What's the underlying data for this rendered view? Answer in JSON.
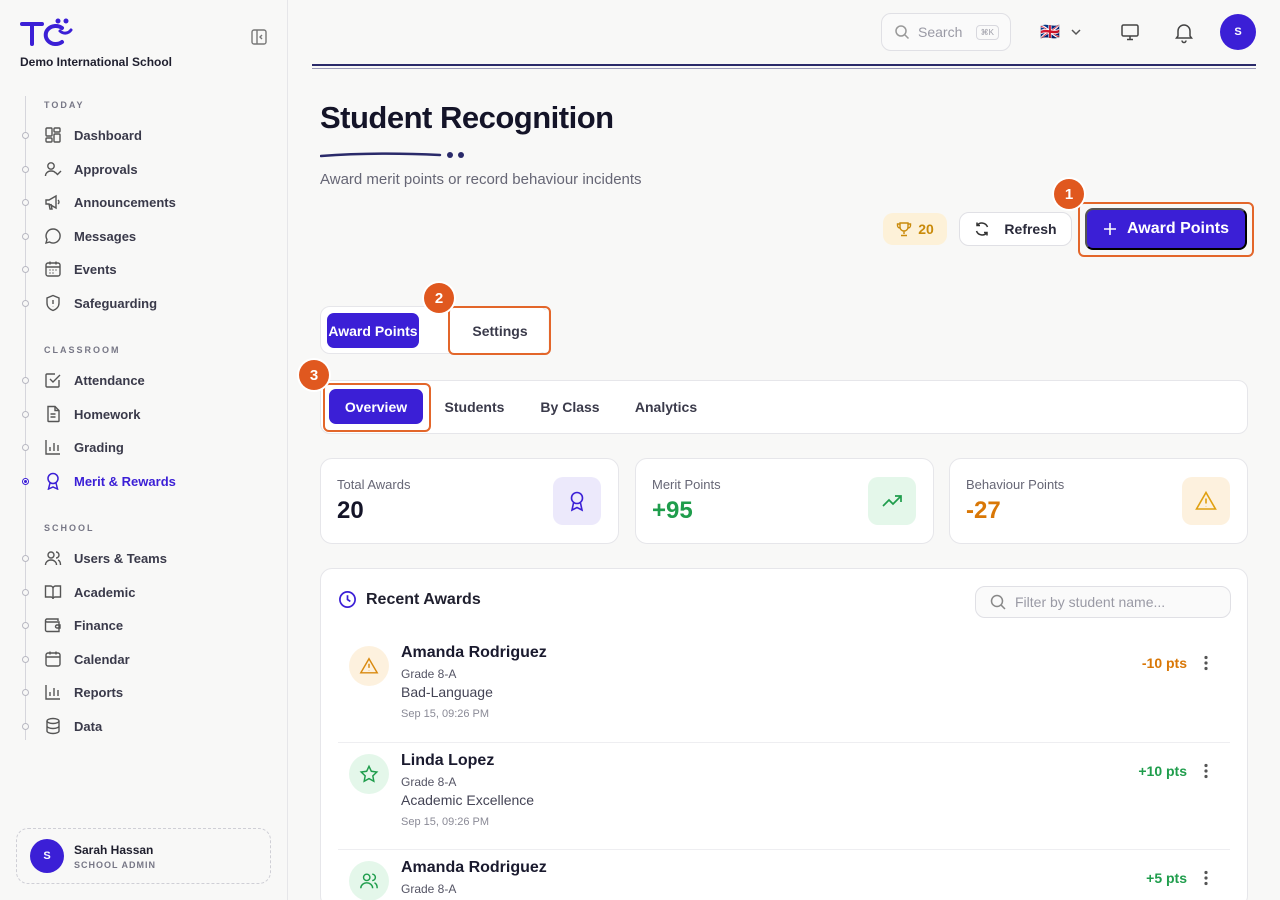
{
  "sidebar": {
    "school_name": "Demo International School",
    "sections": {
      "today": "TODAY",
      "classroom": "CLASSROOM",
      "school": "SCHOOL"
    },
    "items": {
      "dashboard": "Dashboard",
      "approvals": "Approvals",
      "announcements": "Announcements",
      "messages": "Messages",
      "events": "Events",
      "safeguarding": "Safeguarding",
      "attendance": "Attendance",
      "homework": "Homework",
      "grading": "Grading",
      "merit": "Merit & Rewards",
      "users": "Users & Teams",
      "academic": "Academic",
      "finance": "Finance",
      "calendar": "Calendar",
      "reports": "Reports",
      "data": "Data"
    },
    "active_item": "merit",
    "user": {
      "initial": "S",
      "name": "Sarah Hassan",
      "role": "SCHOOL ADMIN"
    }
  },
  "topbar": {
    "search_placeholder": "Search",
    "search_shortcut": "⌘K",
    "language_flag": "🇬🇧",
    "avatar_initial": "S"
  },
  "header": {
    "title": "Student Recognition",
    "subtitle": "Award merit points or record behaviour incidents",
    "points_count": "20",
    "refresh_label": "Refresh",
    "award_label": "Award Points"
  },
  "callouts": [
    "1",
    "2",
    "3"
  ],
  "primary_tabs": {
    "award": "Award Points",
    "settings": "Settings"
  },
  "sub_tabs": {
    "overview": "Overview",
    "students": "Students",
    "by_class": "By Class",
    "analytics": "Analytics"
  },
  "stats": [
    {
      "label": "Total Awards",
      "value": "20",
      "color": "#141428"
    },
    {
      "label": "Merit Points",
      "value": "+95",
      "color": "#1f9d4c"
    },
    {
      "label": "Behaviour Points",
      "value": "-27",
      "color": "#d97706"
    }
  ],
  "recent": {
    "title": "Recent Awards",
    "filter_placeholder": "Filter by student name...",
    "rows": [
      {
        "name": "Amanda Rodriguez",
        "grade": "Grade 8-A",
        "reason": "Bad-Language",
        "time": "Sep 15, 09:26 PM",
        "points": "-10 pts",
        "icon": "warning-icon"
      },
      {
        "name": "Linda Lopez",
        "grade": "Grade 8-A",
        "reason": "Academic Excellence",
        "time": "Sep 15, 09:26 PM",
        "points": "+10 pts",
        "icon": "star-icon"
      },
      {
        "name": "Amanda Rodriguez",
        "grade": "Grade 8-A",
        "reason": "",
        "time": "",
        "points": "+5 pts",
        "icon": "users-icon"
      }
    ]
  },
  "colors": {
    "brand": "#3b1fd6",
    "callout": "#e0581f",
    "positive": "#1f9d4c",
    "negative": "#d97706"
  }
}
